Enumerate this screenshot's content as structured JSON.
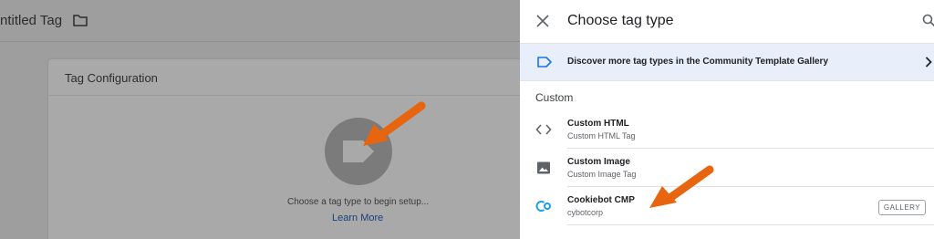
{
  "workspace": {
    "title": "ntitled Tag",
    "card": {
      "title": "Tag Configuration",
      "hint": "Choose a tag type to begin setup...",
      "learn_more": "Learn More"
    }
  },
  "panel": {
    "title": "Choose tag type",
    "banner": "Discover more tag types in the Community Template Gallery",
    "section": "Custom",
    "items": [
      {
        "title": "Custom HTML",
        "subtitle": "Custom HTML Tag",
        "icon": "code-icon"
      },
      {
        "title": "Custom Image",
        "subtitle": "Custom Image Tag",
        "icon": "image-icon"
      },
      {
        "title": "Cookiebot CMP",
        "subtitle": "cybotcorp",
        "icon": "cookiebot-logo-icon",
        "badge": "GALLERY"
      }
    ]
  },
  "colors": {
    "accent_blue": "#1a73e8",
    "cookiebot_blue": "#1aa0e3",
    "annotation_orange": "#e8650f"
  }
}
